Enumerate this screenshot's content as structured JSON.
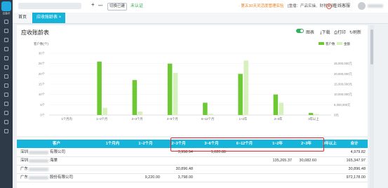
{
  "app": {
    "logo_text": "云会计"
  },
  "topbar": {
    "plus": "+",
    "dots": "•••",
    "switch_label": "切换已建",
    "cert_label": "未认证",
    "promo": "· 第五30天灵活度管理实验",
    "news": "[重播：产品实操、财税新政]",
    "consult": "在线客服"
  },
  "tabs": [
    {
      "label": "首页"
    },
    {
      "label": "应收账龄表"
    }
  ],
  "page": {
    "title": "应收账龄表",
    "toggle_label": "图表",
    "download": "下载",
    "print": "打印",
    "refresh": "刷新"
  },
  "chart_data": {
    "type": "bar",
    "left_axis_title": "客户数(个)",
    "legend": [
      "客户数",
      "金额"
    ],
    "categories": [
      "1个月内",
      "1~2个月",
      "2~3个月",
      "3~6个月",
      "6~12个月",
      "1~2年",
      "2~3年",
      "3年以上"
    ],
    "series": [
      {
        "name": "客户数",
        "axis": "left",
        "values": [
          0,
          26,
          17,
          25,
          6,
          20,
          10,
          1
        ],
        "color": "#6cc934"
      },
      {
        "name": "金额",
        "axis": "right",
        "values": [
          0,
          3500000,
          1700000,
          20500000,
          600000,
          26500000,
          6000000,
          500000
        ],
        "color": "#d7f1bd"
      }
    ],
    "left_ticks": [
      "0个",
      "5个",
      "10个",
      "15个",
      "20个",
      "25个",
      "30个"
    ],
    "left_ylim": [
      0,
      30
    ],
    "right_ticks": [
      "0元",
      "5,000,000元",
      "10,000,000元",
      "15,000,000元",
      "20,000,000元",
      "25,000,000元"
    ],
    "right_ylim": [
      0,
      25000000
    ]
  },
  "table": {
    "headers": [
      "客户",
      "1个月内",
      "1~2个月",
      "2~3个月",
      "3~6个月",
      "6~12个月",
      "1~2年",
      "2~3年",
      "3年以上",
      "合计"
    ],
    "rows": [
      {
        "customer": "深圳",
        "customer_suffix": "有限公司",
        "cells": [
          "",
          "",
          "3,958.94",
          "1,020.88",
          "",
          "",
          "",
          "",
          "4,979.82"
        ]
      },
      {
        "customer": "深圳",
        "customer_suffix": "海棠",
        "cells": [
          "",
          "",
          "",
          "",
          "",
          "135,265.37",
          "30,082.60",
          "",
          "165,347.97"
        ]
      },
      {
        "customer": "广东",
        "customer_suffix": "",
        "cells": [
          "",
          "",
          "30,896.48",
          "",
          "",
          "",
          "",
          "",
          "30,896.48"
        ]
      },
      {
        "customer": "广东",
        "customer_suffix": "股份有限公司",
        "cells": [
          "",
          "9,220.00",
          "3,798.00",
          "",
          "",
          "",
          "",
          "",
          "972,178.00"
        ]
      }
    ]
  }
}
